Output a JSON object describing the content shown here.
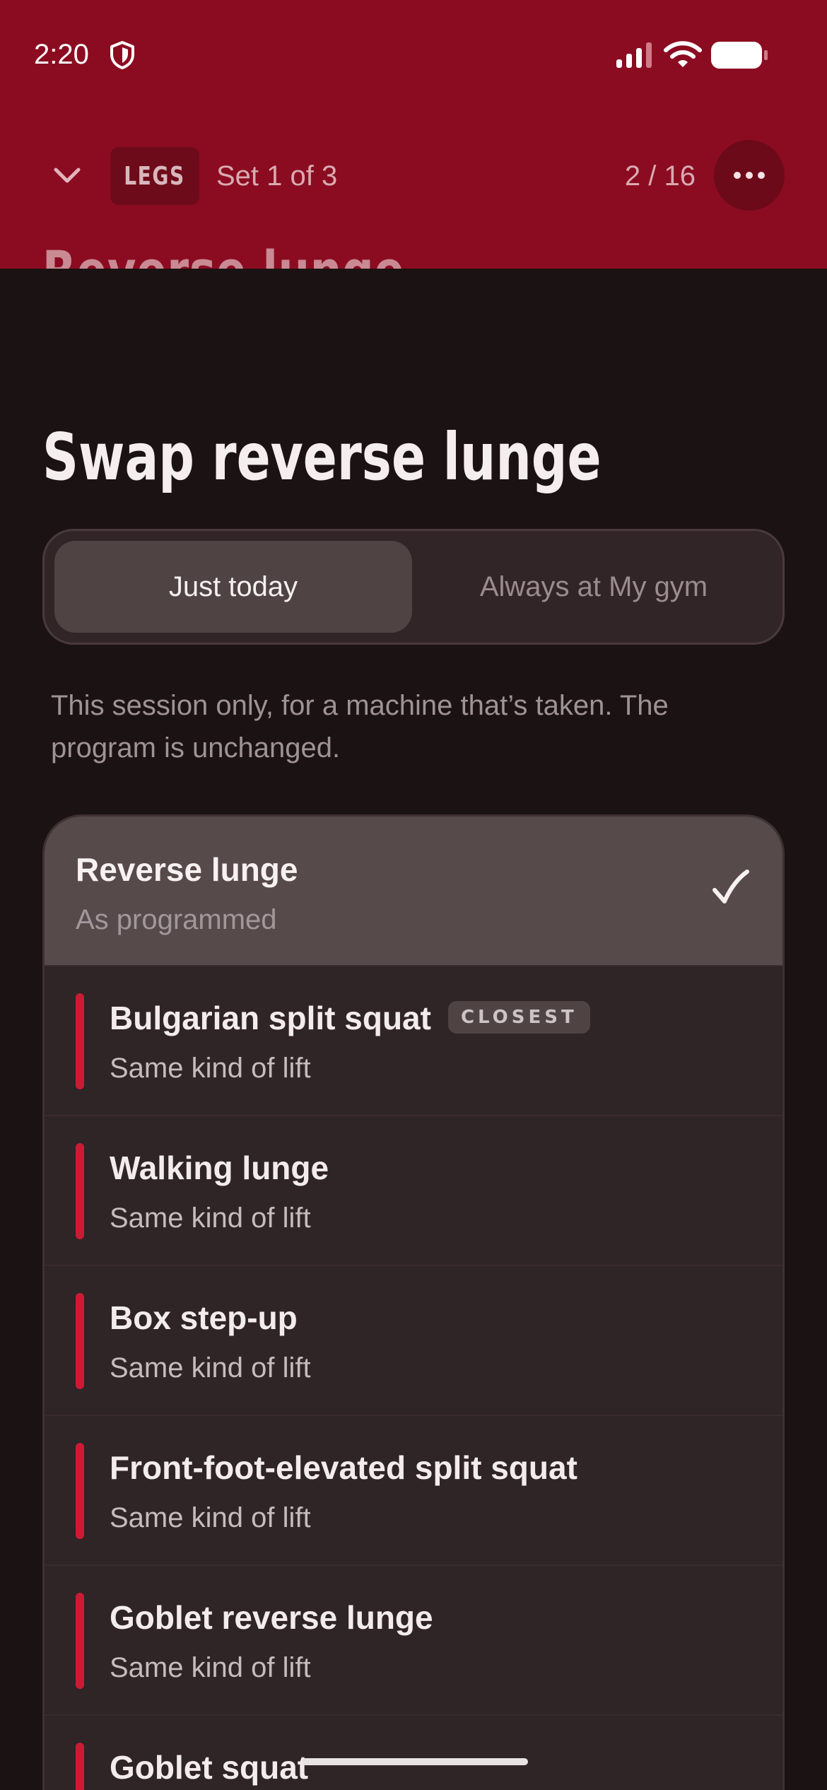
{
  "status_bar": {
    "time": "2:20"
  },
  "header": {
    "category_badge": "LEGS",
    "set_label": "Set 1 of 3",
    "progress": "2 / 16",
    "exercise_title": "Reverse lunge"
  },
  "sheet": {
    "title": "Swap reverse lunge",
    "segments": [
      {
        "label": "Just today",
        "selected": true
      },
      {
        "label": "Always at My gym",
        "selected": false
      }
    ],
    "description": "This session only, for a machine that’s taken. The program is unchanged.",
    "current": {
      "name": "Reverse lunge",
      "subtitle": "As programmed"
    },
    "alternatives": [
      {
        "name": "Bulgarian split squat",
        "subtitle": "Same kind of lift",
        "badge": "CLOSEST"
      },
      {
        "name": "Walking lunge",
        "subtitle": "Same kind of lift"
      },
      {
        "name": "Box step-up",
        "subtitle": "Same kind of lift"
      },
      {
        "name": "Front-foot-elevated split squat",
        "subtitle": "Same kind of lift"
      },
      {
        "name": "Goblet reverse lunge",
        "subtitle": "Same kind of lift"
      },
      {
        "name": "Goblet squat",
        "subtitle": ""
      }
    ]
  },
  "colors": {
    "header_red": "#8b0c21",
    "accent_red": "#cc1a35",
    "sheet_background": "#1b1213"
  }
}
